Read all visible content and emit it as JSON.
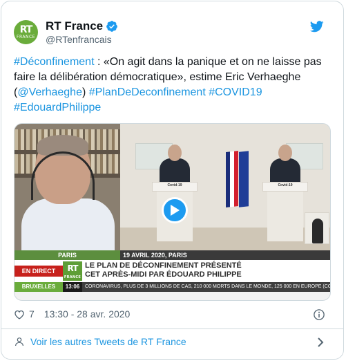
{
  "account": {
    "display_name": "RT France",
    "handle": "@RTenfrancais",
    "avatar_text_top": "RT",
    "avatar_text_bottom": "FRANCE"
  },
  "tweet": {
    "segments": [
      {
        "text": "#Déconfinement",
        "link": true
      },
      {
        "text": " : «On agit dans la panique et on ne laisse pas faire la délibération démocratique», estime Eric Verhaeghe (",
        "link": false
      },
      {
        "text": "@Verhaeghe",
        "link": true
      },
      {
        "text": ") ",
        "link": false
      },
      {
        "text": "#PlanDeDeconfinement",
        "link": true
      },
      {
        "text": " ",
        "link": false
      },
      {
        "text": "#COVID19",
        "link": true
      },
      {
        "text": " ",
        "link": false
      },
      {
        "text": "#EdouardPhilippe",
        "link": true
      }
    ]
  },
  "video": {
    "podium_sign_left": "Covid-19",
    "podium_sign_right": "Covid-19",
    "place_label": "PARIS",
    "date_label": "19 AVRIL 2020, PARIS",
    "live_label": "EN DIRECT",
    "logo_text": "RT",
    "logo_sub": "FRANCE",
    "headline_line1": "LE PLAN DE DÉCONFINEMENT PRÉSENTÉ",
    "headline_line2": "CET APRÈS-MIDI PAR ÉDOUARD PHILIPPE",
    "ticker_city": "BRUXELLES",
    "ticker_time": "13:06",
    "ticker_text": "CORONAVIRUS, PLUS DE 3 MILLIONS DE CAS, 210 000 MORTS DANS LE MONDE, 125 000 EN EUROPE (COMPTAGE AFP)"
  },
  "meta": {
    "like_count": "7",
    "timestamp": "13:30 - 28 avr. 2020"
  },
  "footer": {
    "more_link": "Voir les autres Tweets de RT France"
  },
  "colors": {
    "link": "#1b95e0",
    "rt_green": "#6aac3b",
    "live_red": "#c7211c"
  }
}
